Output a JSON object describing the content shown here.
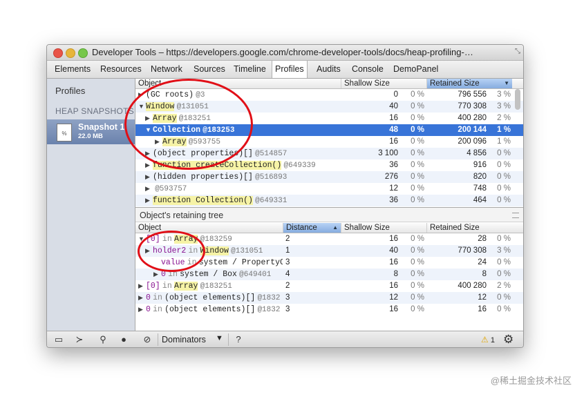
{
  "window": {
    "title": "Developer Tools – https://developers.google.com/chrome-developer-tools/docs/heap-profiling-…",
    "resize_icon": "⤡"
  },
  "tabs": [
    "Elements",
    "Resources",
    "Network",
    "Sources",
    "Timeline",
    "Profiles",
    "Audits",
    "Console",
    "DemoPanel"
  ],
  "active_tab": "Profiles",
  "sidebar": {
    "heading": "Profiles",
    "category": "HEAP SNAPSHOTS",
    "snapshot_name": "Snapshot 1",
    "snapshot_size": "22.0 MB",
    "file_icon_label": "%"
  },
  "top_table": {
    "headers": {
      "object": "Object",
      "shallow": "Shallow Size",
      "retained": "Retained Size",
      "sort_arrow": "▼"
    },
    "rows": [
      {
        "tri": "▶",
        "name": "(GC roots)",
        "id": "@3",
        "shallow": "0",
        "shallow_pct": "0 %",
        "retained": "796 556",
        "retained_pct": "3 %"
      },
      {
        "tri": "▼",
        "name": "Window",
        "id": "@131051",
        "shallow": "40",
        "shallow_pct": "0 %",
        "retained": "770 308",
        "retained_pct": "3 %"
      },
      {
        "tri": "▶",
        "name": "Array",
        "id": "@183251",
        "shallow": "16",
        "shallow_pct": "0 %",
        "retained": "400 280",
        "retained_pct": "2 %"
      },
      {
        "tri": "▼",
        "name": "Collection",
        "id": "@183253",
        "shallow": "48",
        "shallow_pct": "0 %",
        "retained": "200 144",
        "retained_pct": "1 %"
      },
      {
        "tri": "▶",
        "name": "Array",
        "id": "@593755",
        "shallow": "16",
        "shallow_pct": "0 %",
        "retained": "200 096",
        "retained_pct": "1 %"
      },
      {
        "tri": "▶",
        "name": "(object properties)[]",
        "id": "@514857",
        "shallow": "3 100",
        "shallow_pct": "0 %",
        "retained": "4 856",
        "retained_pct": "0 %"
      },
      {
        "tri": "▶",
        "name": "function createCollection()",
        "id": "@649339",
        "shallow": "36",
        "shallow_pct": "0 %",
        "retained": "916",
        "retained_pct": "0 %"
      },
      {
        "tri": "▶",
        "name": "(hidden properties)[]",
        "id": "@516893",
        "shallow": "276",
        "shallow_pct": "0 %",
        "retained": "820",
        "retained_pct": "0 %"
      },
      {
        "tri": "▶",
        "name": "",
        "id": "@593757",
        "shallow": "12",
        "shallow_pct": "0 %",
        "retained": "748",
        "retained_pct": "0 %"
      },
      {
        "tri": "▶",
        "name": "function Collection()",
        "id": "@649331",
        "shallow": "36",
        "shallow_pct": "0 %",
        "retained": "464",
        "retained_pct": "0 %"
      }
    ]
  },
  "retaining_tree": {
    "title": "Object's retaining tree",
    "headers": {
      "object": "Object",
      "distance": "Distance",
      "shallow": "Shallow Size",
      "retained": "Retained Size",
      "sort_arrow": "▲"
    },
    "rows": [
      {
        "tri": "▼",
        "index": "[0]",
        "kw": "in",
        "name": "Array",
        "id": "@183259",
        "distance": "2",
        "shallow": "16",
        "shallow_pct": "0 %",
        "retained": "28",
        "retained_pct": "0 %"
      },
      {
        "tri": "▶",
        "index": "holder2",
        "kw": "in",
        "name": "Window",
        "id": "@131051",
        "distance": "1",
        "shallow": "40",
        "shallow_pct": "0 %",
        "retained": "770 308",
        "retained_pct": "3 %"
      },
      {
        "tri": "",
        "index": "value",
        "kw": "in",
        "name": "system / PropertyCe",
        "id": "",
        "distance": "3",
        "shallow": "16",
        "shallow_pct": "0 %",
        "retained": "24",
        "retained_pct": "0 %"
      },
      {
        "tri": "▶",
        "index": "0",
        "kw": "in",
        "name": "system / Box",
        "id": "@649401",
        "distance": "4",
        "shallow": "8",
        "shallow_pct": "0 %",
        "retained": "8",
        "retained_pct": "0 %"
      },
      {
        "tri": "▶",
        "index": "[0]",
        "kw": "in",
        "name": "Array",
        "id": "@183251",
        "distance": "2",
        "shallow": "16",
        "shallow_pct": "0 %",
        "retained": "400 280",
        "retained_pct": "2 %"
      },
      {
        "tri": "▶",
        "index": "0",
        "kw": "in",
        "name": "(object elements)[]",
        "id": "@1832",
        "distance": "3",
        "shallow": "12",
        "shallow_pct": "0 %",
        "retained": "12",
        "retained_pct": "0 %"
      },
      {
        "tri": "▶",
        "index": "0",
        "kw": "in",
        "name": "(object elements)[]",
        "id": "@1832",
        "distance": "3",
        "shallow": "16",
        "shallow_pct": "0 %",
        "retained": "16",
        "retained_pct": "0 %"
      }
    ]
  },
  "statusbar": {
    "dock_icon": "▭",
    "console_icon": "≻",
    "search_icon": "⚲",
    "record_icon": "●",
    "clear_icon": "⊘",
    "view": "Dominators",
    "dropdown_arrow": "▼",
    "help": "?",
    "warning_icon": "⚠",
    "warning_count": "1",
    "settings_icon": "⚙"
  },
  "watermark": "@稀土掘金技术社区",
  "colors": {
    "selection": "#3874d8",
    "annotation": "#e10f17",
    "highlight": "#f6f3a6"
  }
}
